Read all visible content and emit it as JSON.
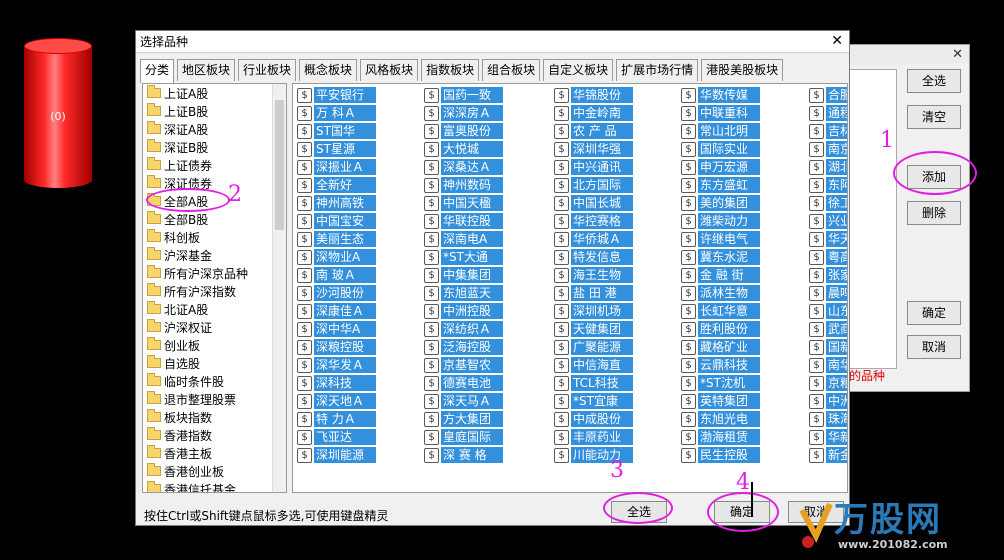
{
  "cylinder": {
    "label": "(0)"
  },
  "back_dialog": {
    "buttons": {
      "select_all": "全选",
      "clear": "清空",
      "add": "添加",
      "delete": "删除",
      "ok": "确定",
      "cancel": "取消"
    },
    "note": "的品种"
  },
  "dialog": {
    "title": "选择品种",
    "close": "✕",
    "tabs": [
      "分类",
      "地区板块",
      "行业板块",
      "概念板块",
      "风格板块",
      "指数板块",
      "组合板块",
      "自定义板块",
      "扩展市场行情",
      "港股美股板块"
    ],
    "active_tab": "分类",
    "tree": [
      "上证A股",
      "上证B股",
      "深证A股",
      "深证B股",
      "上证债券",
      "深证债券",
      "全部A股",
      "全部B股",
      "科创板",
      "沪深基金",
      "所有沪深京品种",
      "所有沪深指数",
      "北证A股",
      "沪深权证",
      "创业板",
      "自选股",
      "临时条件股",
      "退市整理股票",
      "板块指数",
      "香港指数",
      "香港主板",
      "香港创业板",
      "香港信托基金"
    ],
    "stock_columns": [
      [
        "平安银行",
        "万 科Ａ",
        "ST国华",
        "ST星源",
        "深振业Ａ",
        "全新好",
        "神州高铁",
        "中国宝安",
        "美丽生态",
        "深物业A",
        "南 玻Ａ",
        "沙河股份",
        "深康佳Ａ",
        "深中华A",
        "深粮控股",
        "深华发Ａ",
        "深科技",
        "深天地Ａ",
        "特 力Ａ",
        "飞亚达",
        "深圳能源"
      ],
      [
        "国药一致",
        "深深房Ａ",
        "富奥股份",
        "大悦城",
        "深桑达Ａ",
        "神州数码",
        "中国天楹",
        "华联控股",
        "深南电A",
        "*ST大通",
        "中集集团",
        "东旭蓝天",
        "中洲控股",
        "深纺织Ａ",
        "泛海控股",
        "京基智农",
        "德赛电池",
        "深天马Ａ",
        "方大集团",
        "皇庭国际",
        "深 赛 格"
      ],
      [
        "华锦股份",
        "中金岭南",
        "农 产 品",
        "深圳华强",
        "中兴通讯",
        "北方国际",
        "中国长城",
        "华控赛格",
        "华侨城Ａ",
        "特发信息",
        "海王生物",
        "盐 田 港",
        "深圳机场",
        "天健集团",
        "广聚能源",
        "中信海直",
        "TCL科技",
        "*ST宜康",
        "中成股份",
        "丰原药业",
        "川能动力"
      ],
      [
        "华数传媒",
        "中联重科",
        "常山北明",
        "国际实业",
        "申万宏源",
        "东方盛虹",
        "美的集团",
        "潍柴动力",
        "许继电气",
        "冀东水泥",
        "金 融 街",
        "派林生物",
        "长虹华意",
        "胜利股份",
        "藏格矿业",
        "云鼎科技",
        "*ST沈机",
        "英特集团",
        "东旭光电",
        "渤海租赁",
        "民生控股"
      ],
      [
        "合肥",
        "通程",
        "吉林",
        "南京",
        "湖北",
        "东阿",
        "徐工",
        "兴业",
        "华天",
        "粤高",
        "张家",
        "晨鸣",
        "山东",
        "武商",
        "国新",
        "南华",
        "京粮",
        "中洲",
        "珠海",
        "华新",
        "新金"
      ]
    ],
    "hint": "按住Ctrl或Shift键点鼠标多选,可使用键盘精灵",
    "buttons": {
      "select_all": "全选",
      "ok": "确定",
      "cancel": "取消"
    }
  },
  "annotations": [
    "1",
    "2",
    "3",
    "4"
  ],
  "watermark": {
    "text": "万股网",
    "url": "www.201082.com"
  }
}
